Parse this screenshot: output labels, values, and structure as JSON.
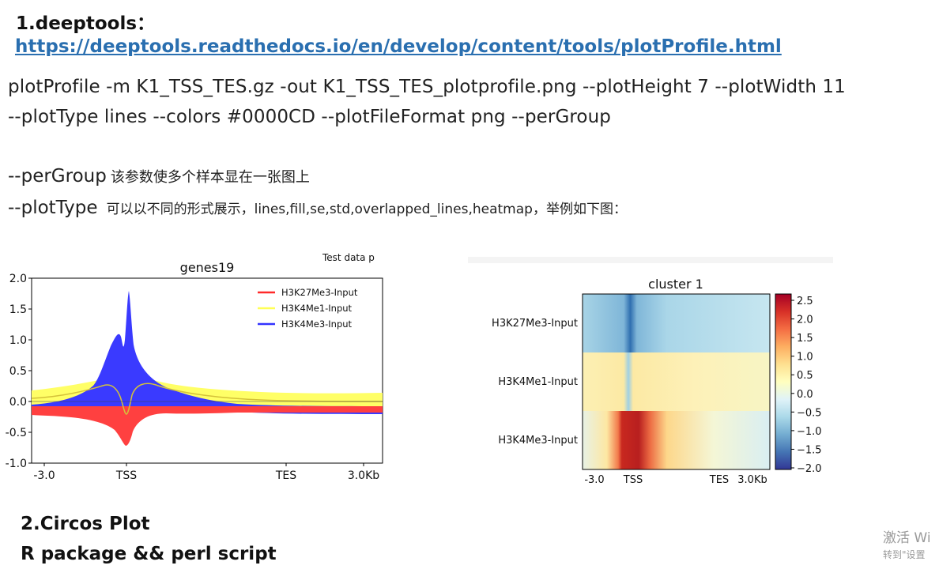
{
  "section1": {
    "title": "1.deeptools：",
    "link": "https://deeptools.readthedocs.io/en/develop/content/tools/plotProfile.html",
    "command_line1": "plotProfile -m K1_TSS_TES.gz -out K1_TSS_TES_plotprofile.png --plotHeight 7 --plotWidth 11",
    "command_line2": "--plotType lines --colors #0000CD --plotFileFormat png --perGroup",
    "param1_name": "--perGroup",
    "param1_desc": "该参数使多个样本显在一张图上",
    "param2_name": "--plotType",
    "param2_desc": "可以以不同的形式展示，lines,fill,se,std,overlapped_lines,heatmap，举例如下图："
  },
  "section2": {
    "title": "2.Circos Plot",
    "subtitle": "R package && perl script"
  },
  "watermark": {
    "line1": "激活 Wi",
    "line2": "转到\"设置"
  },
  "chart_data": [
    {
      "type": "area",
      "title": "genes19",
      "title_cropped": "Test data p",
      "xlabel": "",
      "ylabel": "",
      "xticks": [
        "-3.0",
        "TSS",
        "TES",
        "3.0Kb"
      ],
      "ylim": [
        -1.0,
        2.0
      ],
      "yticks": [
        "2.0",
        "1.5",
        "1.0",
        "0.5",
        "0.0",
        "-0.5",
        "-1.0"
      ],
      "legend_position": "top-right",
      "series": [
        {
          "name": "H3K27Me3-Input",
          "color": "#ff2a2a",
          "x": [
            "-3.0",
            "-1.5",
            "TSS",
            "0.75",
            "TES",
            "3.0Kb"
          ],
          "values": [
            -0.05,
            -0.3,
            -0.65,
            -0.12,
            -0.02,
            -0.02
          ]
        },
        {
          "name": "H3K4Me1-Input",
          "color": "#ffff55",
          "x": [
            "-3.0",
            "-1.5",
            "TSS",
            "0.75",
            "TES",
            "3.0Kb"
          ],
          "values": [
            0.18,
            0.28,
            -0.1,
            0.3,
            0.12,
            0.12
          ]
        },
        {
          "name": "H3K4Me3-Input",
          "color": "#3333ff",
          "x": [
            "-3.0",
            "-0.4",
            "-0.15",
            "TSS",
            "0.2",
            "0.75",
            "TES",
            "3.0Kb"
          ],
          "values": [
            0.0,
            1.1,
            0.95,
            1.78,
            0.7,
            0.15,
            -0.1,
            -0.1
          ]
        }
      ]
    },
    {
      "type": "heatmap",
      "title": "cluster 1",
      "rows": [
        "H3K27Me3-Input",
        "H3K4Me1-Input",
        "H3K4Me3-Input"
      ],
      "xticks": [
        "-3.0",
        "TSS",
        "TES",
        "3.0Kb"
      ],
      "colorbar_ticks": [
        "2.5",
        "2.0",
        "1.5",
        "1.0",
        "0.5",
        "0.0",
        "−0.5",
        "−1.0",
        "−1.5",
        "−2.0"
      ],
      "colorbar_range": [
        -2.0,
        2.5
      ],
      "colormap": [
        "#313695",
        "#4575b4",
        "#74add1",
        "#abd9e9",
        "#e0f3f8",
        "#ffffbf",
        "#fee090",
        "#fdae61",
        "#f46d43",
        "#d73027",
        "#a50026"
      ]
    }
  ]
}
